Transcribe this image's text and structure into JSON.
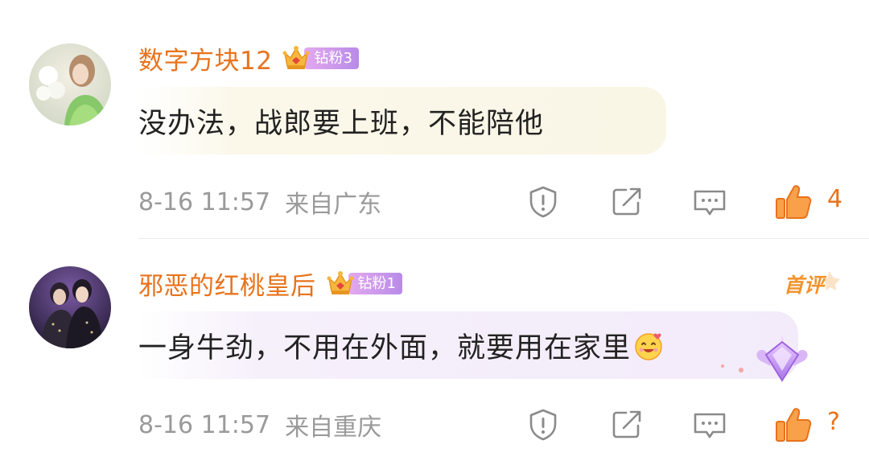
{
  "comments": [
    {
      "username": "数字方块12",
      "fan_badge": "钻粉3",
      "text": "没办法，战郎要上班，不能陪他",
      "time": "8-16 11:57",
      "location": "来自广东",
      "likes": "4"
    },
    {
      "username": "邪恶的红桃皇后",
      "fan_badge": "钻粉1",
      "text": "一身牛劲，不用在外面，就要用在家里",
      "time": "8-16 11:57",
      "location": "来自重庆",
      "likes": "?",
      "first_tag": "首评"
    }
  ],
  "colors": {
    "username": "#e8731c",
    "meta": "#9a9a9a",
    "fan_badge": "#c898ea",
    "bubble_1": "#faf6e6",
    "bubble_2": "#f3ebfa"
  },
  "icons": [
    "report-icon",
    "share-icon",
    "reply-icon",
    "like-icon",
    "crown-icon",
    "emoji-smile-icon",
    "diamond-badge-icon"
  ]
}
